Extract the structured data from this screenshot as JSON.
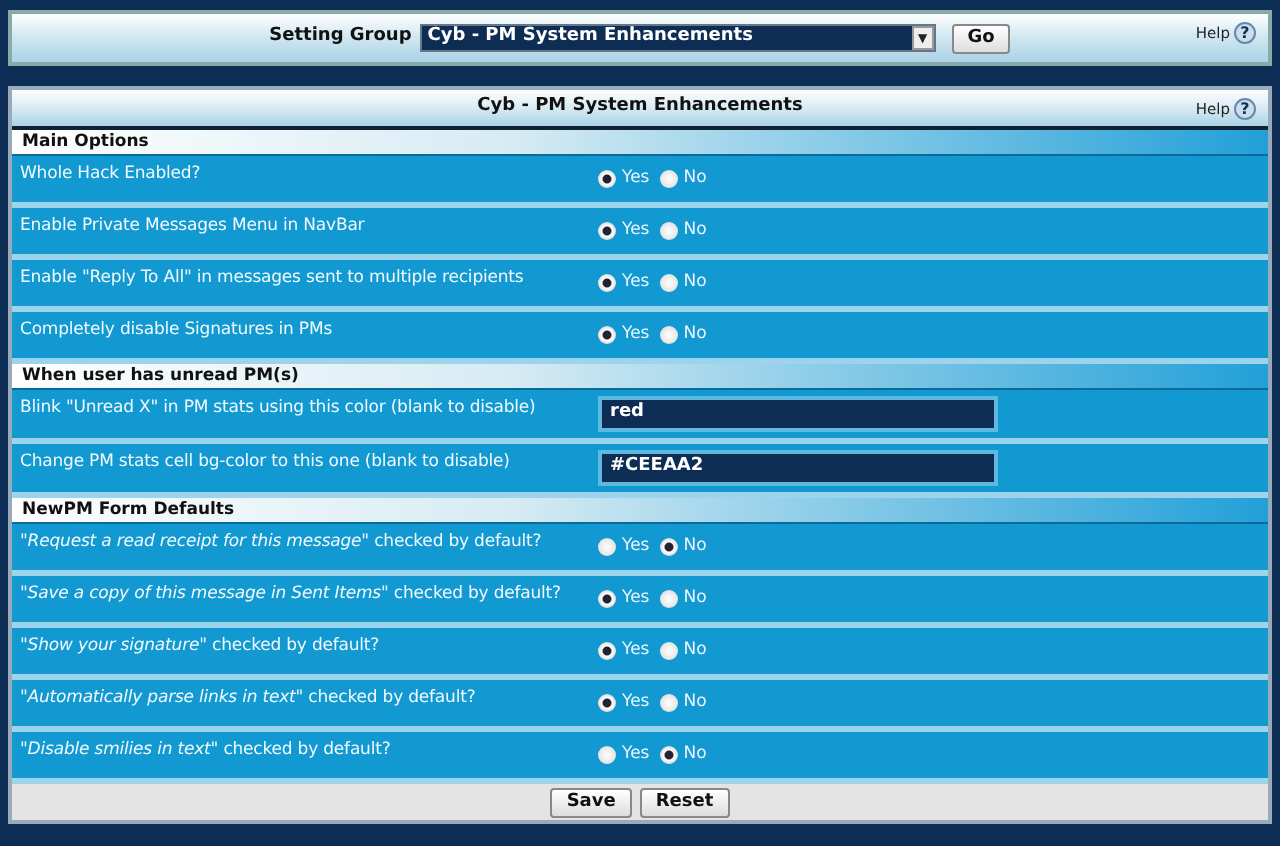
{
  "top_bar": {
    "label": "Setting Group",
    "select_value": "Cyb - PM System Enhancements",
    "caret": "▼",
    "go_button": "Go",
    "help": {
      "label": "Help",
      "icon": "?"
    }
  },
  "panel": {
    "title": "Cyb - PM System Enhancements",
    "help": {
      "label": "Help",
      "icon": "?"
    },
    "sections": [
      {
        "title": "Main Options",
        "rows": [
          {
            "label": "Whole Hack Enabled?",
            "kind": "radio",
            "options": [
              {
                "label": "Yes",
                "selected": true
              },
              {
                "label": "No",
                "selected": false
              }
            ]
          },
          {
            "label": "Enable Private Messages Menu in NavBar",
            "kind": "radio",
            "options": [
              {
                "label": "Yes",
                "selected": true
              },
              {
                "label": "No",
                "selected": false
              }
            ]
          },
          {
            "label": "Enable \"Reply To All\" in messages sent to multiple recipients",
            "kind": "radio",
            "options": [
              {
                "label": "Yes",
                "selected": true
              },
              {
                "label": "No",
                "selected": false
              }
            ]
          },
          {
            "label": "Completely disable Signatures in PMs",
            "kind": "radio",
            "options": [
              {
                "label": "Yes",
                "selected": true
              },
              {
                "label": "No",
                "selected": false
              }
            ]
          }
        ]
      },
      {
        "title": "When user has unread PM(s)",
        "rows": [
          {
            "label": "Blink \"Unread X\" in PM stats using this color (blank to disable)",
            "kind": "text",
            "value": "red"
          },
          {
            "label": "Change PM stats cell bg-color to this one (blank to disable)",
            "kind": "text",
            "value": "#CEEAA2"
          }
        ]
      },
      {
        "title": "NewPM Form Defaults",
        "rows": [
          {
            "label": "*\"Request a read receipt for this message\"* checked by default?",
            "kind": "radio",
            "options": [
              {
                "label": "Yes",
                "selected": false
              },
              {
                "label": "No",
                "selected": true
              }
            ]
          },
          {
            "label": "*\"Save a copy of this message in Sent Items\"* checked by default?",
            "kind": "radio",
            "options": [
              {
                "label": "Yes",
                "selected": true
              },
              {
                "label": "No",
                "selected": false
              }
            ]
          },
          {
            "label": "*\"Show your signature\"* checked by default?",
            "kind": "radio",
            "options": [
              {
                "label": "Yes",
                "selected": true
              },
              {
                "label": "No",
                "selected": false
              }
            ]
          },
          {
            "label": "*\"Automatically parse links in text\"* checked by default?",
            "kind": "radio",
            "options": [
              {
                "label": "Yes",
                "selected": true
              },
              {
                "label": "No",
                "selected": false
              }
            ]
          },
          {
            "label": "*\"Disable smilies in text\"* checked by default?",
            "kind": "radio",
            "options": [
              {
                "label": "Yes",
                "selected": false
              },
              {
                "label": "No",
                "selected": true
              }
            ]
          }
        ]
      }
    ],
    "buttons": [
      "Save",
      "Reset"
    ]
  }
}
